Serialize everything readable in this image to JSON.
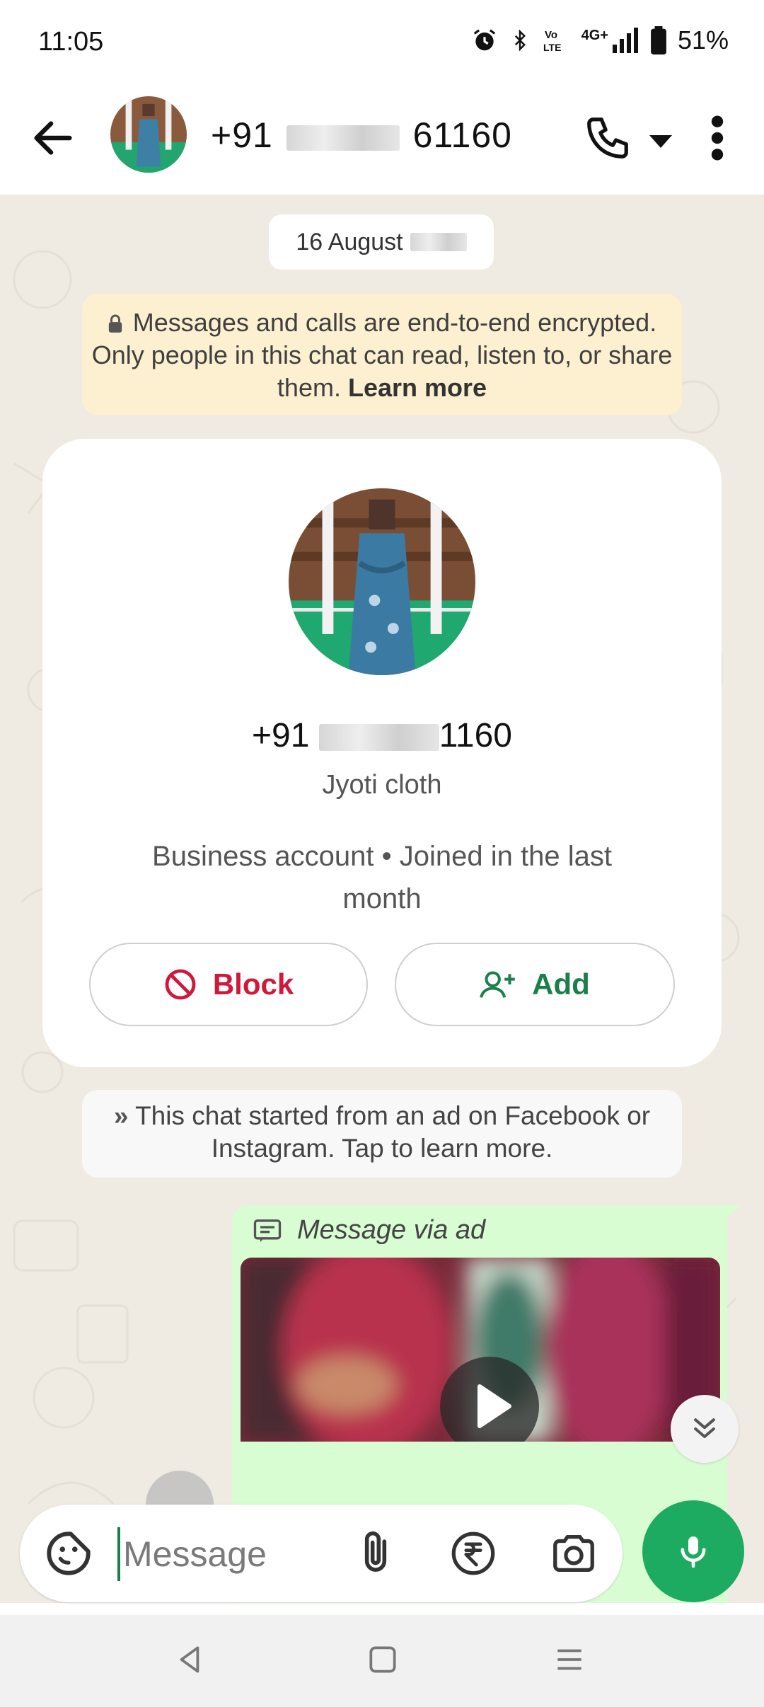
{
  "status_bar": {
    "time": "11:05",
    "network": "4G+",
    "battery": "51%"
  },
  "header": {
    "title_prefix": "+91",
    "title_suffix": "61160",
    "menu_icon": "more-vert-icon",
    "call_icon": "phone-icon"
  },
  "chat": {
    "date_chip": "16 August",
    "encryption_notice": "Messages and calls are end-to-end encrypted. Only people in this chat can read, listen to, or share them.",
    "encryption_link": "Learn more",
    "business_card": {
      "phone_prefix": "+91",
      "phone_suffix": "1160",
      "name": "Jyoti cloth",
      "description": "Business account • Joined in the last month",
      "block_label": "Block",
      "add_label": "Add"
    },
    "ad_notice": "This chat started from an ad on Facebook or Instagram. Tap to learn more.",
    "message": {
      "header": "Message via ad"
    }
  },
  "composer": {
    "placeholder": "Message"
  },
  "colors": {
    "accent_green": "#1daa61",
    "block_red": "#d0193a",
    "add_green": "#1a7f4a",
    "chat_bg": "#efeae2",
    "encryption_bg": "#fdf0d0",
    "bubble_green": "#d9fdd3"
  }
}
